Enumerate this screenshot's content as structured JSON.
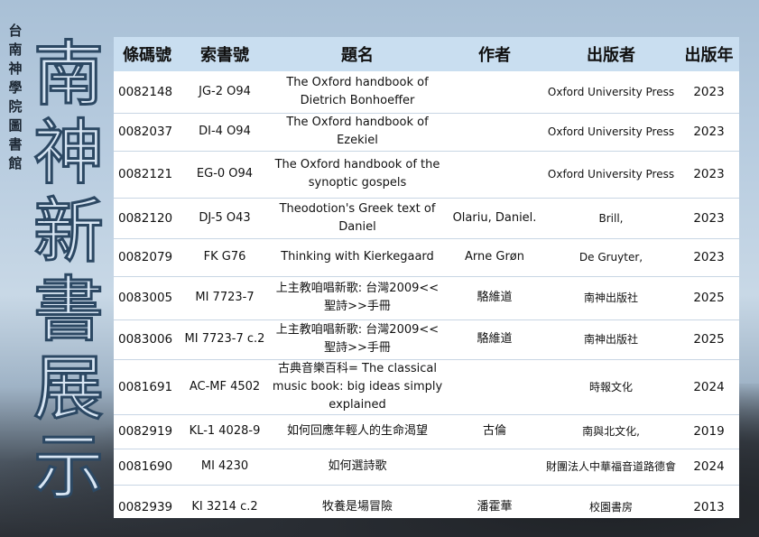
{
  "sidebar": {
    "library_name": "台南神學院圖書館",
    "exhibit_title": "南神新書展示"
  },
  "table": {
    "headers": [
      "條碼號",
      "索書號",
      "題名",
      "作者",
      "出版者",
      "出版年"
    ],
    "rows": [
      {
        "barcode": "0082148",
        "call_number": "JG-2 O94",
        "title": "The Oxford handbook of Dietrich Bonhoeffer",
        "author": "",
        "publisher": "Oxford University Press",
        "year": "2023"
      },
      {
        "barcode": "0082037",
        "call_number": "DI-4 O94",
        "title": "The Oxford handbook of Ezekiel",
        "author": "",
        "publisher": "Oxford University Press",
        "year": "2023"
      },
      {
        "barcode": "0082121",
        "call_number": "EG-0 O94",
        "title": "The Oxford handbook of the synoptic gospels",
        "author": "",
        "publisher": "Oxford University Press",
        "year": "2023"
      },
      {
        "barcode": "0082120",
        "call_number": "DJ-5 O43",
        "title": "Theodotion's Greek text of Daniel",
        "author": "Olariu, Daniel.",
        "publisher": "Brill,",
        "year": "2023"
      },
      {
        "barcode": "0082079",
        "call_number": "FK G76",
        "title": "Thinking with Kierkegaard",
        "author": "Arne Grøn",
        "publisher": "De Gruyter,",
        "year": "2023"
      },
      {
        "barcode": "0083005",
        "call_number": "MI 7723-7",
        "title": "上主教咱唱新歌: 台灣2009<<聖詩>>手冊",
        "author": "駱維道",
        "publisher": "南神出版社",
        "year": "2025"
      },
      {
        "barcode": "0083006",
        "call_number": "MI 7723-7 c.2",
        "title": "上主教咱唱新歌: 台灣2009<<聖詩>>手冊",
        "author": "駱維道",
        "publisher": "南神出版社",
        "year": "2025"
      },
      {
        "barcode": "0081691",
        "call_number": "AC-MF 4502",
        "title": "古典音樂百科= The classical music book: big ideas simply explained",
        "author": "",
        "publisher": "時報文化",
        "year": "2024"
      },
      {
        "barcode": "0082919",
        "call_number": "KL-1 4028-9",
        "title": "如何回應年輕人的生命渴望",
        "author": "古倫",
        "publisher": "南與北文化,",
        "year": "2019"
      },
      {
        "barcode": "0081690",
        "call_number": "MI 4230",
        "title": "如何選詩歌",
        "author": "",
        "publisher": "財團法人中華福音道路德會",
        "year": "2024"
      },
      {
        "barcode": "0082939",
        "call_number": "KI 3214 c.2",
        "title": "牧養是場冒險",
        "author": "潘霍華",
        "publisher": "校園書房",
        "year": "2013"
      }
    ]
  },
  "colors": {
    "header_bg": "#c9def0",
    "title_stroke": "#2c4863",
    "title_fill": "#d8e6f4"
  }
}
